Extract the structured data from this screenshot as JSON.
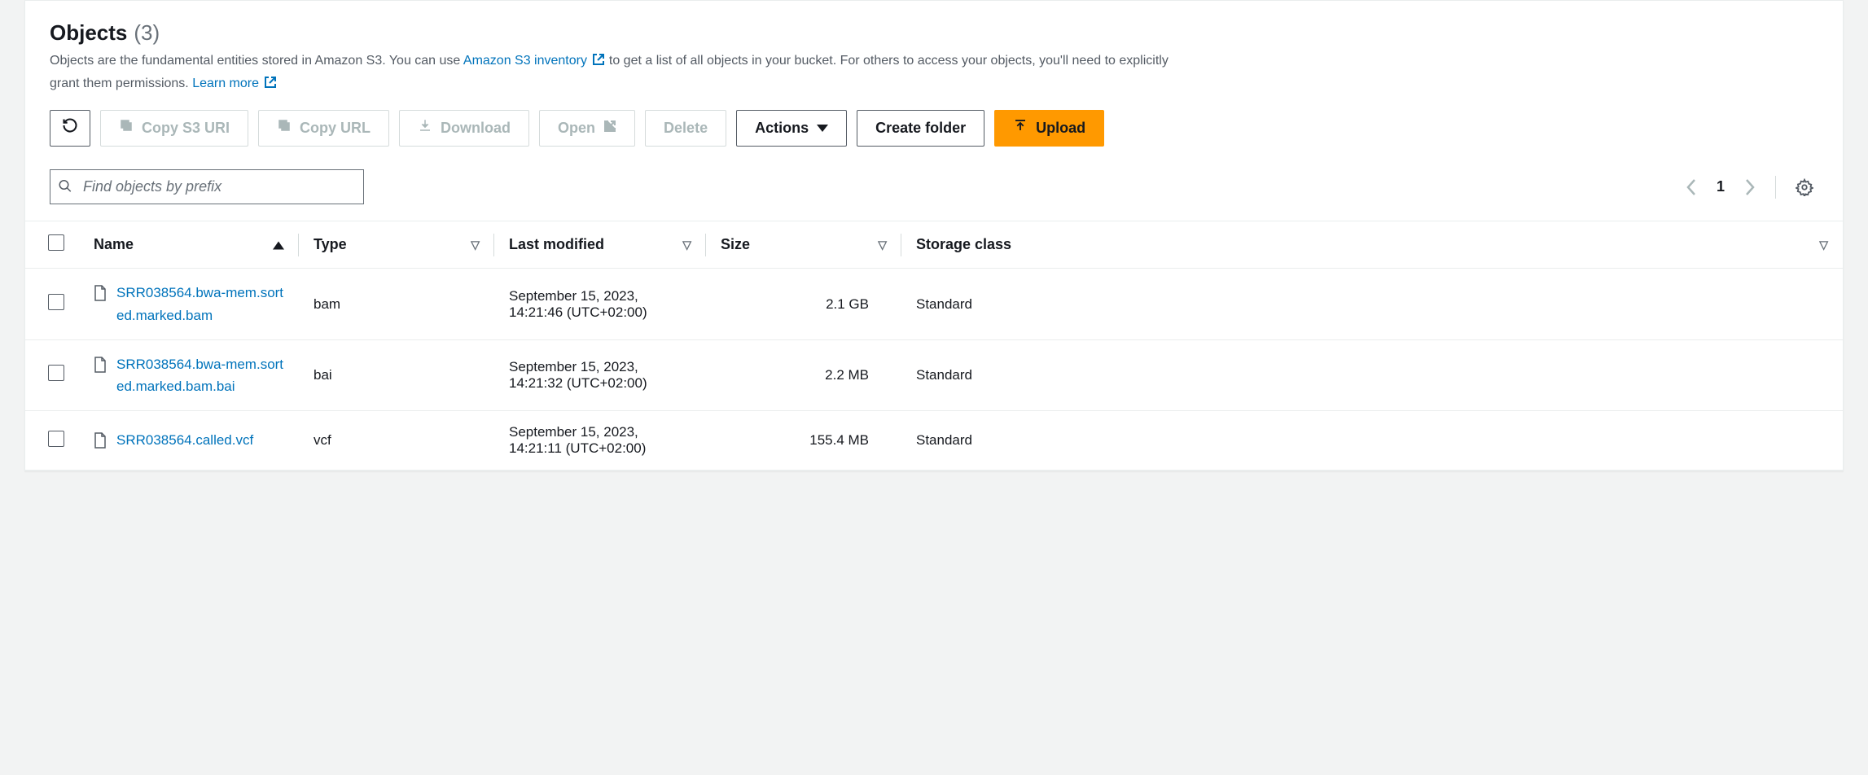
{
  "header": {
    "title": "Objects",
    "count": "(3)",
    "desc_before": "Objects are the fundamental entities stored in Amazon S3. You can use ",
    "inventory_link": "Amazon S3 inventory",
    "desc_mid": " to get a list of all objects in your bucket. For others to access your objects, you'll need to explicitly grant them permissions. ",
    "learn_more": "Learn more"
  },
  "toolbar": {
    "copy_s3_uri": "Copy S3 URI",
    "copy_url": "Copy URL",
    "download": "Download",
    "open": "Open",
    "delete": "Delete",
    "actions": "Actions",
    "create_folder": "Create folder",
    "upload": "Upload"
  },
  "search": {
    "placeholder": "Find objects by prefix"
  },
  "pager": {
    "page": "1"
  },
  "columns": {
    "name": "Name",
    "type": "Type",
    "last_modified": "Last modified",
    "size": "Size",
    "storage_class": "Storage class"
  },
  "rows": [
    {
      "name": "SRR038564.bwa-mem.sorted.marked.bam",
      "type": "bam",
      "last_modified": "September 15, 2023, 14:21:46 (UTC+02:00)",
      "size": "2.1 GB",
      "storage_class": "Standard"
    },
    {
      "name": "SRR038564.bwa-mem.sorted.marked.bam.bai",
      "type": "bai",
      "last_modified": "September 15, 2023, 14:21:32 (UTC+02:00)",
      "size": "2.2 MB",
      "storage_class": "Standard"
    },
    {
      "name": "SRR038564.called.vcf",
      "type": "vcf",
      "last_modified": "September 15, 2023, 14:21:11 (UTC+02:00)",
      "size": "155.4 MB",
      "storage_class": "Standard"
    }
  ]
}
